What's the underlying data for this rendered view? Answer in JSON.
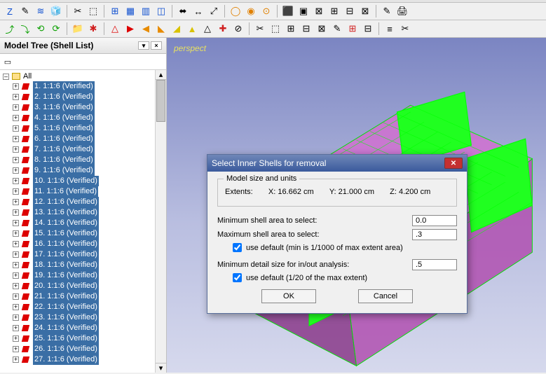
{
  "toolbar1": {
    "icons": [
      "Z",
      "✎",
      "≋",
      "🧊",
      "✂",
      "⬚",
      "⊞",
      "▦",
      "▥",
      "◫",
      "⬌",
      "↔",
      "⤢",
      "◯",
      "◉",
      "⊙",
      "⬛",
      "▣",
      "⊠",
      "⊞",
      "⊟",
      "⊠",
      "✎",
      "🖨"
    ]
  },
  "toolbar2": {
    "icons": [
      "⤴",
      "⤵",
      "⟲",
      "⟳",
      "📁",
      "✱",
      "",
      "△",
      "▶",
      "◀",
      "◣",
      "◢",
      "▲",
      "△",
      "✚",
      "⊘",
      "✂",
      "⬚",
      "⊞",
      "⊟",
      "⊠",
      "✎",
      "⊞",
      "⊟",
      "",
      "≡",
      "✂"
    ]
  },
  "panel": {
    "title": "Model Tree (Shell List)",
    "root": "All",
    "items": [
      "1. 1:1:6 (Verified)",
      "2. 1:1:6 (Verified)",
      "3. 1:1:6 (Verified)",
      "4. 1:1:6 (Verified)",
      "5. 1:1:6 (Verified)",
      "6. 1:1:6 (Verified)",
      "7. 1:1:6 (Verified)",
      "8. 1:1:6 (Verified)",
      "9. 1:1:6 (Verified)",
      "10. 1:1:6 (Verified)",
      "11. 1:1:6 (Verified)",
      "12. 1:1:6 (Verified)",
      "13. 1:1:6 (Verified)",
      "14. 1:1:6 (Verified)",
      "15. 1:1:6 (Verified)",
      "16. 1:1:6 (Verified)",
      "17. 1:1:6 (Verified)",
      "18. 1:1:6 (Verified)",
      "19. 1:1:6 (Verified)",
      "20. 1:1:6 (Verified)",
      "21. 1:1:6 (Verified)",
      "22. 1:1:6 (Verified)",
      "23. 1:1:6 (Verified)",
      "24. 1:1:6 (Verified)",
      "25. 1:1:6 (Verified)",
      "26. 1:1:6 (Verified)",
      "27. 1:1:6 (Verified)"
    ]
  },
  "viewport": {
    "label": "perspect"
  },
  "dialog": {
    "title": "Select Inner Shells for removal",
    "group_legend": "Model size and units",
    "extents_label": "Extents:",
    "extents_x": "X: 16.662 cm",
    "extents_y": "Y: 21.000 cm",
    "extents_z": "Z: 4.200 cm",
    "min_area_label": "Minimum shell area to select:",
    "min_area_value": "0.0",
    "max_area_label": "Maximum shell area to select:",
    "max_area_value": ".3",
    "use_default_area_label": "use default (min is 1/1000 of max extent area)",
    "min_detail_label": "Minimum detail size for in/out analysis:",
    "min_detail_value": ".5",
    "use_default_detail_label": "use default (1/20 of the max extent)",
    "ok": "OK",
    "cancel": "Cancel"
  }
}
